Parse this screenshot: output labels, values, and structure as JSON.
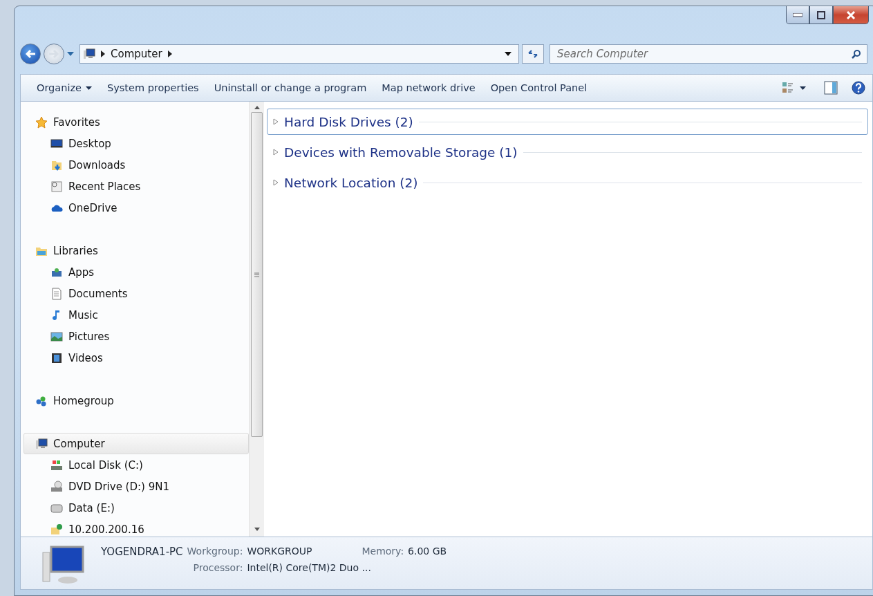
{
  "address_bar": {
    "path": [
      "Computer"
    ]
  },
  "search": {
    "placeholder": "Search Computer"
  },
  "toolbar": {
    "buttons": [
      {
        "label": "Organize",
        "dropdown": true
      },
      {
        "label": "System properties",
        "dropdown": false
      },
      {
        "label": "Uninstall or change a program",
        "dropdown": false
      },
      {
        "label": "Map network drive",
        "dropdown": false
      },
      {
        "label": "Open Control Panel",
        "dropdown": false
      }
    ]
  },
  "sidebar": {
    "sections": [
      {
        "label": "Favorites",
        "kind": "favorites",
        "selected": false,
        "children": [
          {
            "label": "Desktop",
            "kind": "desktop",
            "selected": false
          },
          {
            "label": "Downloads",
            "kind": "downloads",
            "selected": false
          },
          {
            "label": "Recent Places",
            "kind": "recent",
            "selected": false
          },
          {
            "label": "OneDrive",
            "kind": "cloud",
            "selected": false
          }
        ]
      },
      {
        "label": "Libraries",
        "kind": "libraries",
        "selected": false,
        "children": [
          {
            "label": "Apps",
            "kind": "apps",
            "selected": false
          },
          {
            "label": "Documents",
            "kind": "documents",
            "selected": false
          },
          {
            "label": "Music",
            "kind": "music",
            "selected": false
          },
          {
            "label": "Pictures",
            "kind": "pictures",
            "selected": false
          },
          {
            "label": "Videos",
            "kind": "videos",
            "selected": false
          }
        ]
      },
      {
        "label": "Homegroup",
        "kind": "homegroup",
        "selected": false
      },
      {
        "label": "Computer",
        "kind": "computer",
        "selected": true,
        "children": [
          {
            "label": "Local Disk (C:)",
            "kind": "disk",
            "selected": false
          },
          {
            "label": "DVD Drive (D:) 9N1",
            "kind": "dvd",
            "selected": false
          },
          {
            "label": "Data (E:)",
            "kind": "drive",
            "selected": false
          },
          {
            "label": "10.200.200.16",
            "kind": "network",
            "selected": false
          }
        ]
      }
    ]
  },
  "groups": [
    {
      "label": "Hard Disk Drives (2)",
      "expanded": false,
      "selected": true
    },
    {
      "label": "Devices with Removable Storage (1)",
      "expanded": false,
      "selected": false
    },
    {
      "label": "Network Location (2)",
      "expanded": false,
      "selected": false
    }
  ],
  "details": {
    "name": "YOGENDRA1-PC",
    "fields": [
      {
        "label": "Workgroup:",
        "value": "WORKGROUP"
      },
      {
        "label": "Memory:",
        "value": "6.00 GB"
      },
      {
        "label": "Processor:",
        "value": "Intel(R) Core(TM)2 Duo ..."
      }
    ]
  }
}
